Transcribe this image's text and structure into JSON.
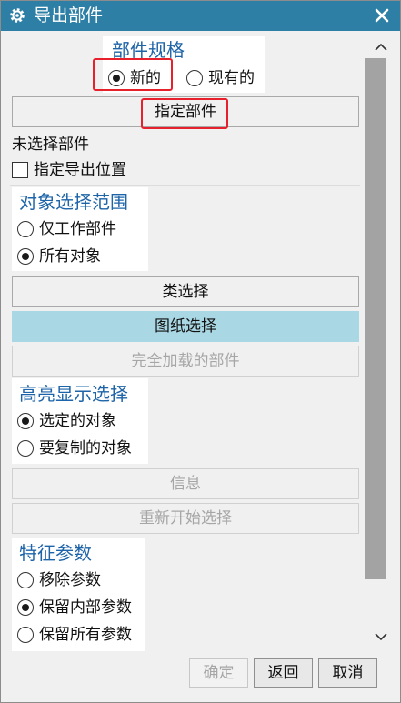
{
  "window": {
    "title": "导出部件"
  },
  "part_spec": {
    "title": "部件规格",
    "options": [
      {
        "label": "新的",
        "selected": true
      },
      {
        "label": "现有的",
        "selected": false
      }
    ],
    "specify_part_button": "指定部件"
  },
  "unselected_parts_text": "未选择部件",
  "export_location": {
    "label": "指定导出位置",
    "checked": false
  },
  "object_scope": {
    "title": "对象选择范围",
    "options": [
      {
        "label": "仅工作部件",
        "selected": false
      },
      {
        "label": "所有对象",
        "selected": true
      }
    ]
  },
  "buttons": {
    "class_select": "类选择",
    "drawing_select": "图纸选择",
    "fully_loaded_parts": "完全加载的部件",
    "info": "信息",
    "restart_select": "重新开始选择"
  },
  "highlight": {
    "title": "高亮显示选择",
    "options": [
      {
        "label": "选定的对象",
        "selected": true
      },
      {
        "label": "要复制的对象",
        "selected": false
      }
    ]
  },
  "feature_params": {
    "title": "特征参数",
    "options": [
      {
        "label": "移除参数",
        "selected": false
      },
      {
        "label": "保留内部参数",
        "selected": true
      },
      {
        "label": "保留所有参数",
        "selected": false
      }
    ]
  },
  "footer": {
    "ok": "确定",
    "back": "返回",
    "cancel": "取消"
  },
  "colors": {
    "titlebar": "#2e7fa6",
    "group_title": "#1e64a8",
    "active_button": "#a9d7e4",
    "highlight_box": "#e8202b"
  }
}
